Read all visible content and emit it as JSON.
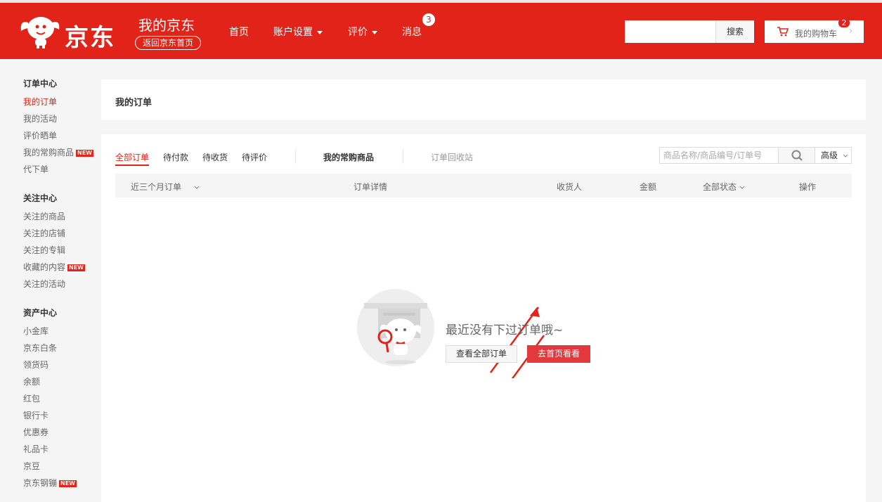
{
  "header": {
    "logo_text": "京东",
    "site_title": "我的京东",
    "back_home": "返回京东首页",
    "nav": [
      {
        "label": "首页"
      },
      {
        "label": "账户设置"
      },
      {
        "label": "评价"
      },
      {
        "label": "消息"
      }
    ],
    "msg_count": "3",
    "search_button": "搜索",
    "cart_label": "我的购物车",
    "cart_count": "2",
    "cart_arrow": "›",
    "brand_color": "#e2231a"
  },
  "sidebar": {
    "groups": [
      {
        "title": "订单中心",
        "items": [
          {
            "label": "我的订单"
          },
          {
            "label": "我的活动"
          },
          {
            "label": "评价晒单"
          },
          {
            "label": "我的常购商品",
            "tag": "NEW"
          },
          {
            "label": "代下单"
          }
        ]
      },
      {
        "title": "关注中心",
        "items": [
          {
            "label": "关注的商品"
          },
          {
            "label": "关注的店铺"
          },
          {
            "label": "关注的专辑"
          },
          {
            "label": "收藏的内容",
            "tag": "NEW"
          },
          {
            "label": "关注的活动"
          }
        ]
      },
      {
        "title": "资产中心",
        "items": [
          {
            "label": "小金库"
          },
          {
            "label": "京东白条"
          },
          {
            "label": "领货码"
          },
          {
            "label": "余额"
          },
          {
            "label": "红包"
          },
          {
            "label": "银行卡"
          },
          {
            "label": "优惠券"
          },
          {
            "label": "礼品卡"
          },
          {
            "label": "京豆"
          },
          {
            "label": "京东钢镚",
            "tag": "NEW"
          }
        ]
      }
    ]
  },
  "main": {
    "title": "我的订单",
    "tabs": [
      {
        "label": "全部订单"
      },
      {
        "label": "待付款"
      },
      {
        "label": "待收货"
      },
      {
        "label": "待评价"
      },
      {
        "label": "我的常购商品"
      },
      {
        "label": "订单回收站"
      }
    ],
    "search_placeholder": "商品名称/商品编号/订单号",
    "advanced": "高级",
    "columns": {
      "period": "近三个月订单",
      "detail": "订单详情",
      "receiver": "收货人",
      "amount": "金额",
      "status": "全部状态",
      "action": "操作"
    },
    "empty": {
      "message": "最近没有下过订单哦~",
      "view_all": "查看全部订单",
      "go_home": "去首页看看"
    }
  }
}
